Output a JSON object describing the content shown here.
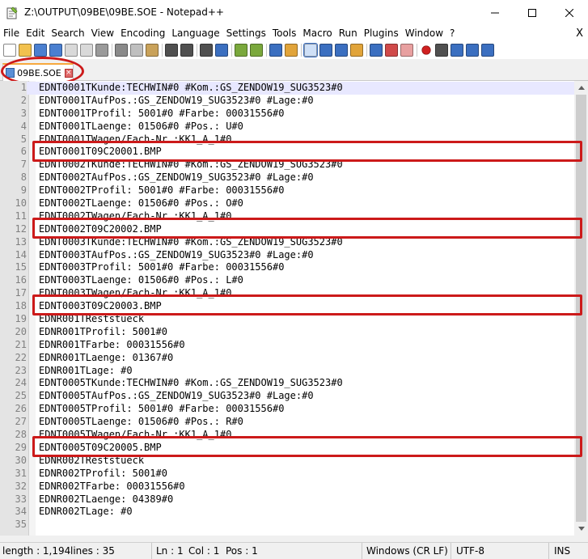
{
  "window": {
    "title": "Z:\\OUTPUT\\09BE\\09BE.SOE - Notepad++",
    "icon": "notepad-plus-plus-icon"
  },
  "menu": {
    "items": [
      "File",
      "Edit",
      "Search",
      "View",
      "Encoding",
      "Language",
      "Settings",
      "Tools",
      "Macro",
      "Run",
      "Plugins",
      "Window",
      "?"
    ],
    "close_glyph": "X"
  },
  "toolbar": {
    "icons": [
      "new-file-icon",
      "open-file-icon",
      "save-icon",
      "save-all-icon",
      "close-icon",
      "close-all-icon",
      "print-icon",
      "cut-icon",
      "copy-icon",
      "paste-icon",
      "undo-icon",
      "redo-icon",
      "find-icon",
      "replace-icon",
      "zoom-in-icon",
      "zoom-out-icon",
      "sync-vertical-icon",
      "sync-horizontal-icon",
      "word-wrap-icon",
      "show-all-chars-icon",
      "indent-guide-icon",
      "document-map-icon",
      "function-list-icon",
      "folder-workspace-icon",
      "monitoring-icon",
      "record-macro-icon",
      "stop-record-icon",
      "play-macro-icon",
      "run-macro-multiple-icon",
      "save-macro-icon"
    ]
  },
  "tab": {
    "label": "09BE.SOE",
    "close_glyph": "×"
  },
  "editor": {
    "lines": [
      "EDNT0001TKunde:TECHWIN#0 #Kom.:GS_ZENDOW19_SUG3523#0",
      "EDNT0001TAufPos.:GS_ZENDOW19_SUG3523#0 #Lage:#0",
      "EDNT0001TProfil: 5001#0 #Farbe: 00031556#0",
      "EDNT0001TLaenge: 01506#0 #Pos.: U#0",
      "EDNT0001TWagen/Fach-Nr.:KK1_A_1#0",
      "EDNT0001T09C20001.BMP",
      "EDNT0002TKunde:TECHWIN#0 #Kom.:GS_ZENDOW19_SUG3523#0",
      "EDNT0002TAufPos.:GS_ZENDOW19_SUG3523#0 #Lage:#0",
      "EDNT0002TProfil: 5001#0 #Farbe: 00031556#0",
      "EDNT0002TLaenge: 01506#0 #Pos.: O#0",
      "EDNT0002TWagen/Fach-Nr.:KK1_A_1#0",
      "EDNT0002T09C20002.BMP",
      "EDNT0003TKunde:TECHWIN#0 #Kom.:GS_ZENDOW19_SUG3523#0",
      "EDNT0003TAufPos.:GS_ZENDOW19_SUG3523#0 #Lage:#0",
      "EDNT0003TProfil: 5001#0 #Farbe: 00031556#0",
      "EDNT0003TLaenge: 01506#0 #Pos.: L#0",
      "EDNT0003TWagen/Fach-Nr.:KK1_A_1#0",
      "EDNT0003T09C20003.BMP",
      "EDNR001TReststueck",
      "EDNR001TProfil: 5001#0",
      "EDNR001TFarbe: 00031556#0",
      "EDNR001TLaenge: 01367#0",
      "EDNR001TLage: #0",
      "EDNT0005TKunde:TECHWIN#0 #Kom.:GS_ZENDOW19_SUG3523#0",
      "EDNT0005TAufPos.:GS_ZENDOW19_SUG3523#0 #Lage:#0",
      "EDNT0005TProfil: 5001#0 #Farbe: 00031556#0",
      "EDNT0005TLaenge: 01506#0 #Pos.: R#0",
      "EDNT0005TWagen/Fach-Nr.:KK1_A_1#0",
      "EDNT0005T09C20005.BMP",
      "EDNR002TReststueck",
      "EDNR002TProfil: 5001#0",
      "EDNR002TFarbe: 00031556#0",
      "EDNR002TLaenge: 04389#0",
      "EDNR002TLage: #0",
      ""
    ],
    "current_line": 1,
    "highlighted_lines": [
      6,
      12,
      18,
      29
    ]
  },
  "status": {
    "length": "length : 1,194",
    "lines": "lines : 35",
    "ln": "Ln : 1",
    "col": "Col : 1",
    "pos": "Pos : 1",
    "eol": "Windows (CR LF)",
    "encoding": "UTF-8",
    "mode": "INS"
  },
  "colors": {
    "annotation": "#cc1a1a",
    "current_line": "#e8e8ff",
    "gutter": "#e4e4e4"
  }
}
